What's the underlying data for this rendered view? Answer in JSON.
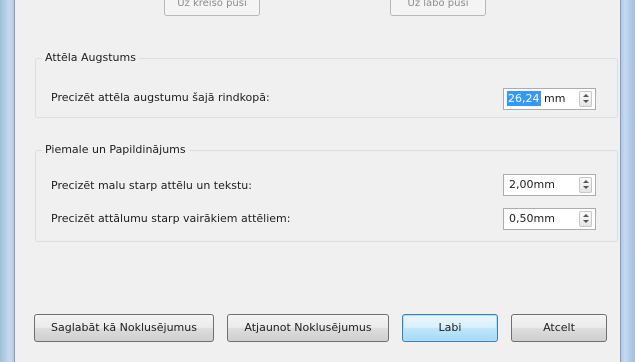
{
  "top_buttons": [
    "Uz kreiso pusi",
    "Uz labo pusi"
  ],
  "image_height_group": {
    "title": "Attēla Augstums",
    "row_label": "Precizēt attēla augstumu šajā rindkopā:",
    "value_selected": "26,24",
    "unit": "mm"
  },
  "margin_group": {
    "title": "Piemale un Papildinājums",
    "rows": [
      {
        "label": "Precizēt malu starp attēlu un tekstu:",
        "value": "2,00mm"
      },
      {
        "label": "Precizēt attālumu starp vairākiem attēliem:",
        "value": "0,50mm"
      }
    ]
  },
  "buttons": {
    "save_default": "Saglabāt kā Noklusējumus",
    "restore_default": "Atjaunot Noklusējumus",
    "ok": "Labi",
    "cancel": "Atcelt"
  }
}
